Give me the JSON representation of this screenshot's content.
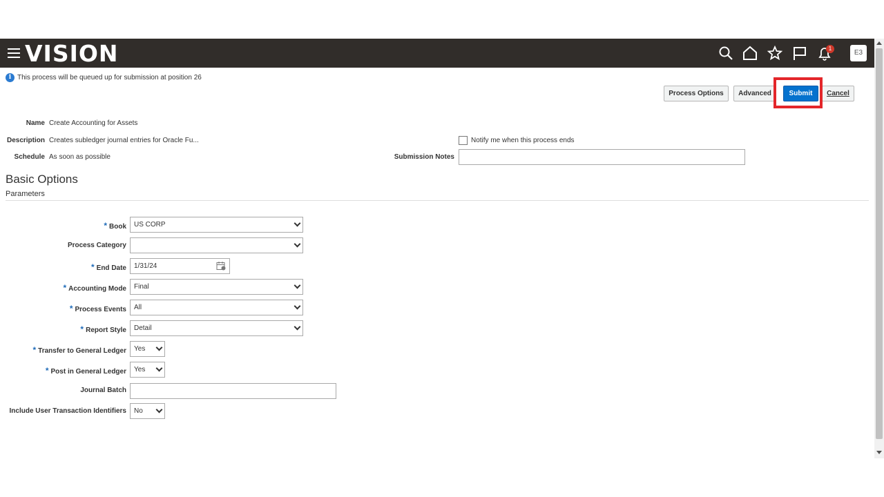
{
  "header": {
    "logo": "VISION",
    "icons": [
      "menu-icon",
      "search-icon",
      "home-icon",
      "star-icon",
      "flag-icon",
      "bell-icon"
    ],
    "notification_count": "1",
    "user_initials": "E3",
    "bg_color": "#312d2a"
  },
  "info_message": "This process will be queued up for submission at position 26",
  "buttons": {
    "process_options": "Process Options",
    "advanced": "Advanced",
    "submit": "Submit",
    "cancel": "Cancel"
  },
  "details": {
    "name_label": "Name",
    "name_value": "Create Accounting for Assets",
    "description_label": "Description",
    "description_value": "Creates subledger journal entries for Oracle Fu...",
    "schedule_label": "Schedule",
    "schedule_value": "As soon as possible",
    "notify_label": "Notify me when this process ends",
    "submission_notes_label": "Submission Notes",
    "submission_notes_value": ""
  },
  "section": {
    "title": "Basic Options",
    "subtitle": "Parameters"
  },
  "parameters": {
    "book": {
      "label": "Book",
      "value": "US CORP",
      "required": "*"
    },
    "process_category": {
      "label": "Process Category",
      "value": ""
    },
    "end_date": {
      "label": "End Date",
      "value": "1/31/24",
      "required": "*"
    },
    "accounting_mode": {
      "label": "Accounting Mode",
      "value": "Final",
      "required": "*"
    },
    "process_events": {
      "label": "Process Events",
      "value": "All",
      "required": "*"
    },
    "report_style": {
      "label": "Report Style",
      "value": "Detail",
      "required": "*"
    },
    "transfer_gl": {
      "label": "Transfer to General Ledger",
      "value": "Yes",
      "required": "*"
    },
    "post_gl": {
      "label": "Post in General Ledger",
      "value": "Yes",
      "required": "*"
    },
    "journal_batch": {
      "label": "Journal Batch",
      "value": ""
    },
    "include_uti": {
      "label": "Include User Transaction Identifiers",
      "value": "No"
    }
  }
}
